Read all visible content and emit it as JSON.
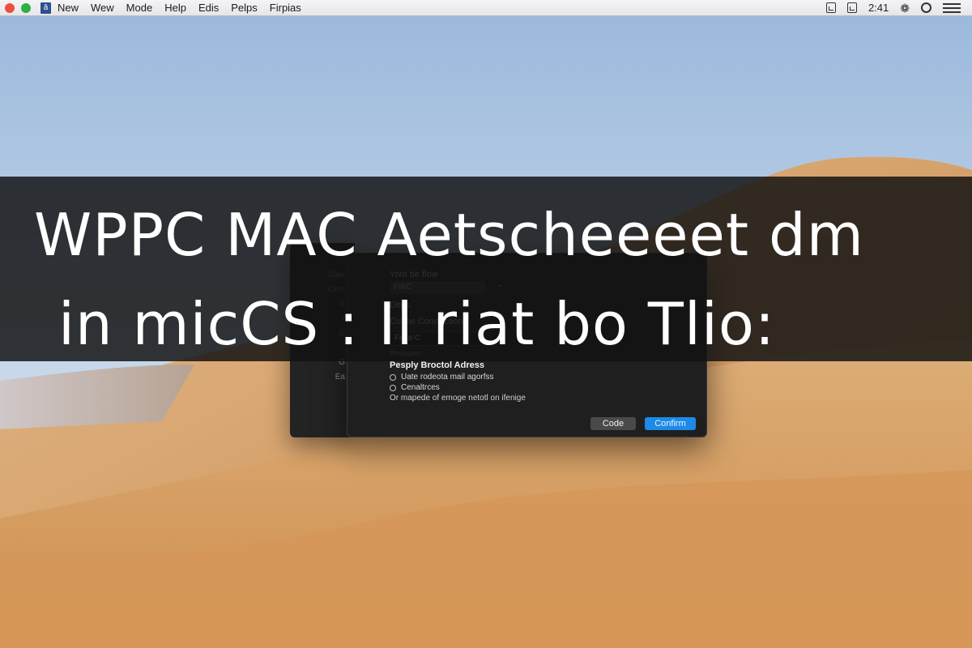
{
  "menubar": {
    "window_controls": [
      "close",
      "zoom"
    ],
    "app_icon": "app-icon",
    "items": [
      "New",
      "Wew",
      "Mode",
      "Help",
      "Edis",
      "Pelps",
      "Firpias"
    ],
    "status_icons": [
      "document-icon",
      "document-edit-icon"
    ],
    "clock": "2:41",
    "extra_icons": [
      "globe-icon",
      "circle-icon",
      "hamburger-icon"
    ]
  },
  "banner": {
    "line1": "WPPC MAC Aetscheeeet dm",
    "line2": "in micCS : Il riat bo Tlio:"
  },
  "dialog_sidebar": {
    "labels": [
      "Gaw",
      "Com",
      "G",
      "r",
      "G",
      "G",
      "Ea"
    ]
  },
  "dialog": {
    "field1_label": "Yont be flow",
    "select_value": "Fill/C",
    "select_chevron": "⌄",
    "field2_label": "Ditus",
    "field3_label": "Cuzee Connection",
    "text_value": "Fella-C",
    "hint": "Roseqoio",
    "section_title": "Pesply Broctol Adress",
    "radio_options": [
      "Uate rodeota mail agorfss",
      "Cenaltrces"
    ],
    "note": "Or mapede of emoge netotl on ifenige",
    "buttons": {
      "cancel": "Code",
      "confirm": "Confirm"
    }
  },
  "colors": {
    "accent": "#1c8ae6",
    "dialog_bg": "#1f1f1f",
    "banner_bg": "#121212",
    "close_dot": "#ee4e3f",
    "zoom_dot": "#2ab240"
  }
}
